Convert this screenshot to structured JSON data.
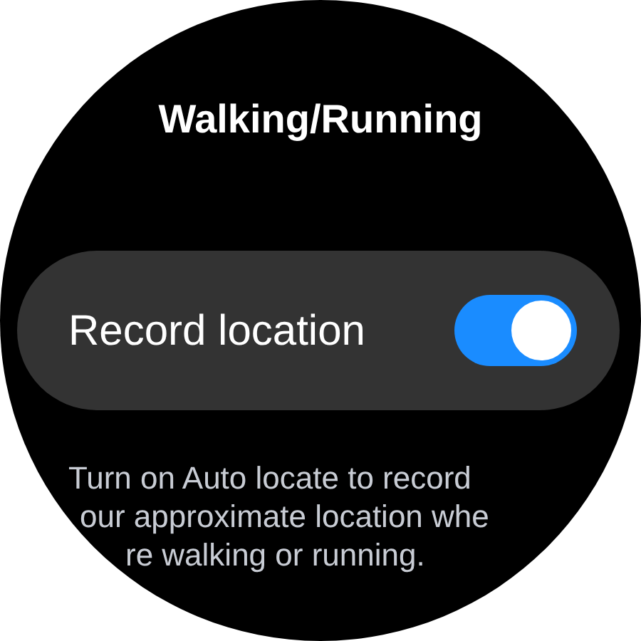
{
  "screen": {
    "title": "Walking/Running"
  },
  "setting": {
    "label": "Record location",
    "on": true
  },
  "description": [
    "Turn on Auto locate to record",
    "our approximate location whe",
    "re walking or running."
  ]
}
